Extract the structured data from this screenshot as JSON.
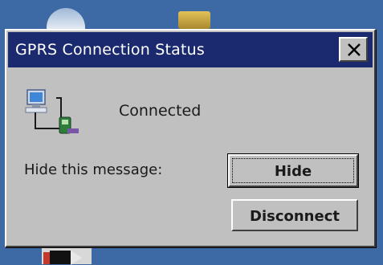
{
  "dialog": {
    "title": "GPRS Connection Status",
    "status": "Connected",
    "hide_label": "Hide this message:",
    "hide_button": "Hide",
    "disconnect_button": "Disconnect",
    "close_icon": "close-icon",
    "status_icon": "network-connection-icon"
  },
  "colors": {
    "titlebar": "#1b2a6e",
    "dialog_bg": "#c0c0c0",
    "desktop": "#3d6aa5"
  }
}
